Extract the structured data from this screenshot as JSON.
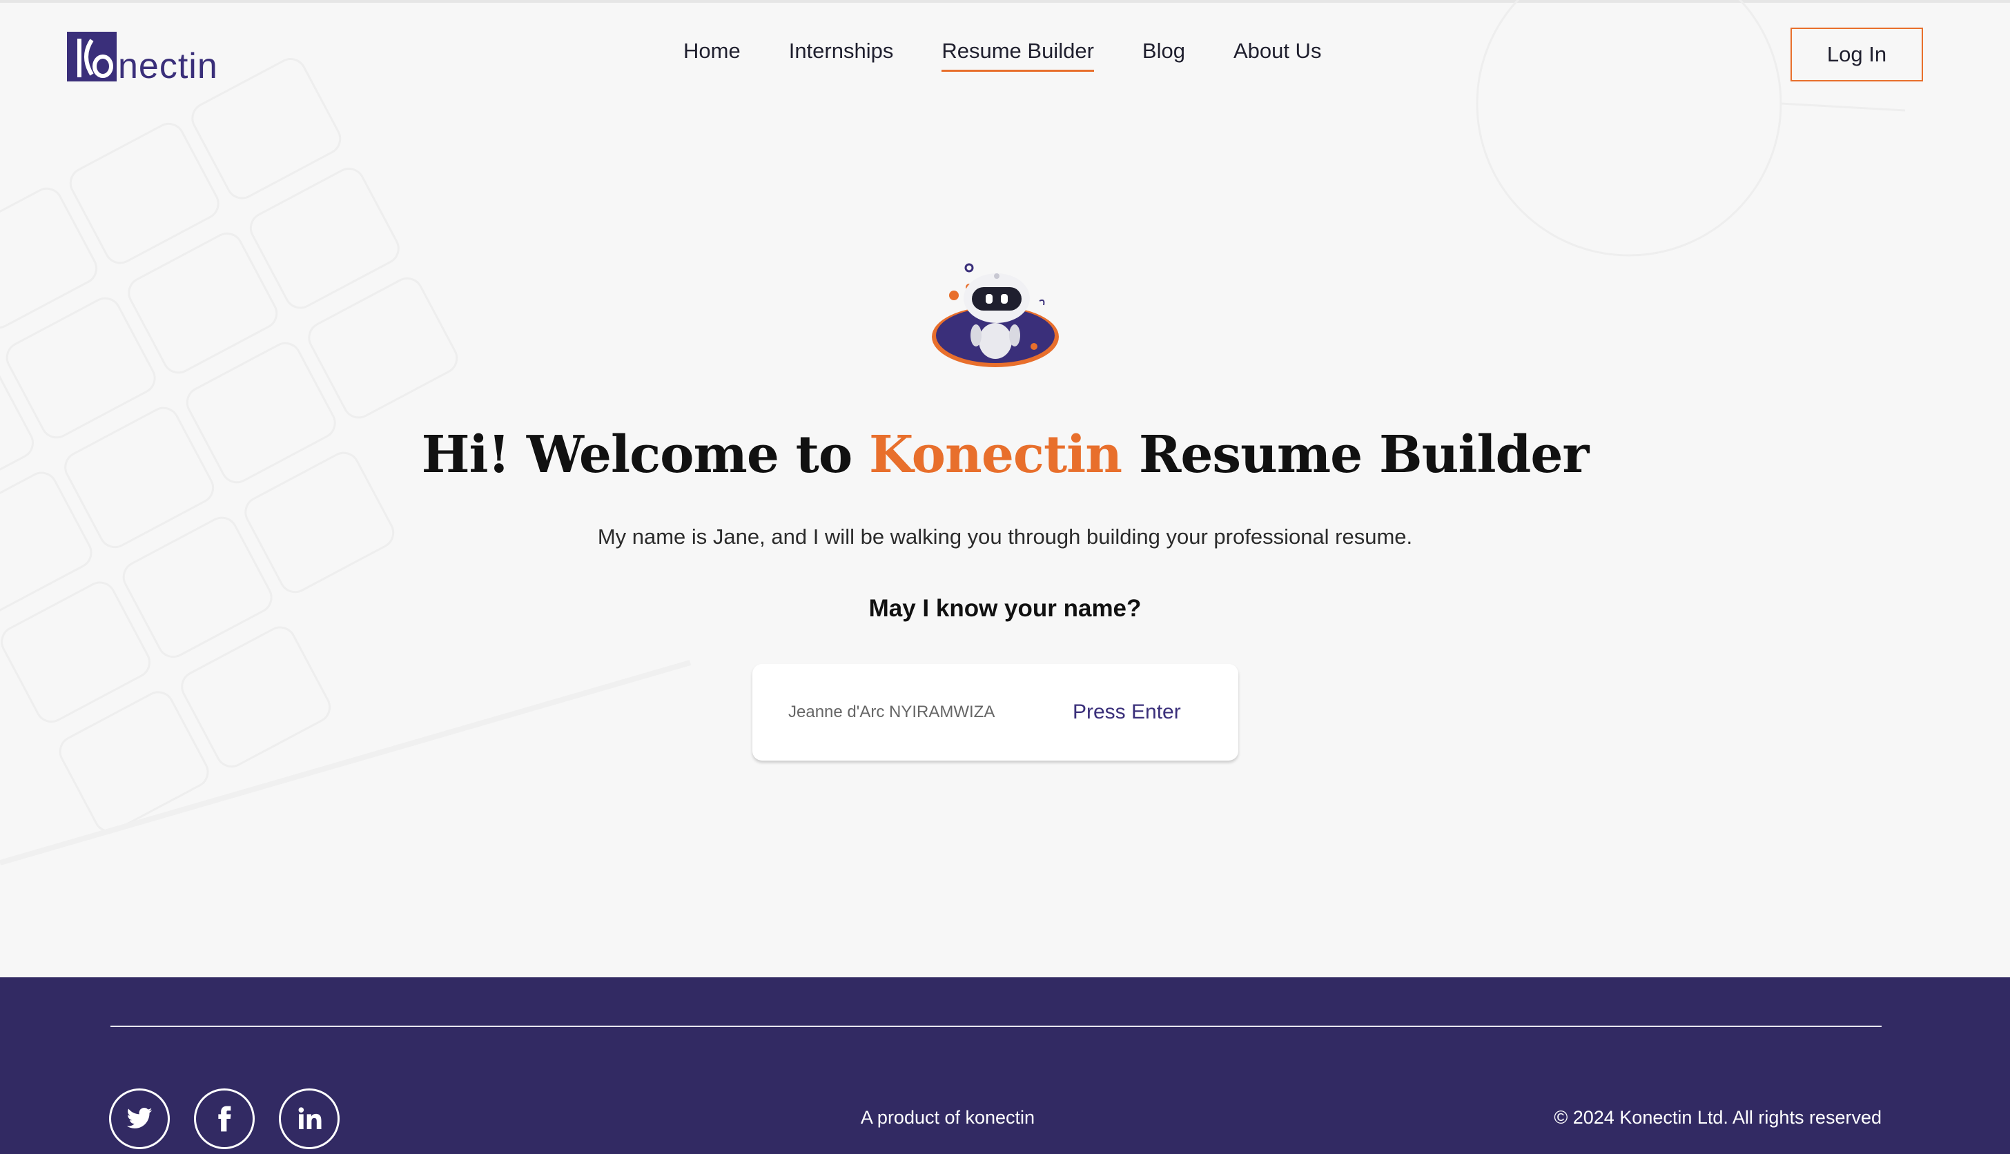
{
  "header": {
    "logo_text": "nectin",
    "logo_mark": "Ko",
    "nav": [
      {
        "label": "Home"
      },
      {
        "label": "Internships"
      },
      {
        "label": "Resume Builder",
        "active": true
      },
      {
        "label": "Blog"
      },
      {
        "label": "About Us"
      }
    ],
    "login_label": "Log In"
  },
  "hero": {
    "title_pre": "Hi! Welcome to ",
    "title_brand": "Konectin",
    "title_post": " Resume Builder",
    "intro": "My name is Jane, and I will be walking you through building your professional resume.",
    "question": "May I know your name?",
    "name_value": "Jeanne d'Arc NYIRAMWIZA",
    "submit_label": "Press Enter",
    "mascot_icon": "robot-mascot-icon"
  },
  "footer": {
    "socials": [
      "twitter-icon",
      "facebook-icon",
      "linkedin-icon"
    ],
    "product": "A product of konectin",
    "copyright": "© 2024 Konectin Ltd. All rights reserved"
  },
  "colors": {
    "brand_purple": "#3a2f7a",
    "footer_bg": "#322a63",
    "accent_orange": "#e86f2c"
  }
}
